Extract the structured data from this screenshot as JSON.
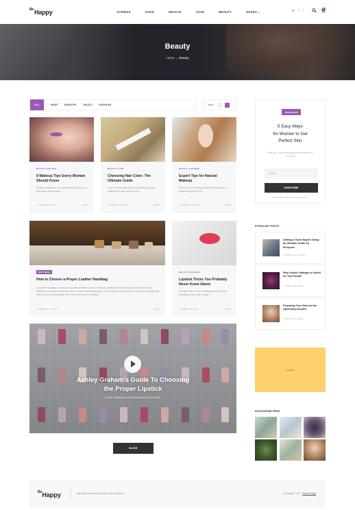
{
  "header": {
    "logo_prefix": "Be",
    "logo_main": "Happy",
    "nav": [
      "FITNESS",
      "FOOD",
      "HEALTH",
      "LOVE",
      "BEAUTY",
      "PAGES"
    ],
    "pages_caret": "⌄",
    "social": [
      "◙",
      "f",
      "t"
    ],
    "cart_count": "0"
  },
  "hero": {
    "title": "Beauty",
    "crumb_home": "Home",
    "crumb_arrow": "→",
    "crumb_current": "Beauty"
  },
  "filter": {
    "items": [
      "ALL",
      "HAIR",
      "MAKEUP",
      "NAILS",
      "FASHION"
    ],
    "view_label": "View"
  },
  "cards": [
    {
      "category": "BEAUTY, MAKEUP",
      "title": "8 Makeup Tips Every Woman Should Know",
      "excerpt": "Makeup techniques now seem easy to follow, but they show great results...",
      "date": "JANUARY 3, 2017",
      "views": "324"
    },
    {
      "category": "BEAUTY, HAIR",
      "title": "Choosing Hair Color: The Ultimate Guide",
      "excerpt": "Your most beautiful hair color will bring out the subtleties of your skin and eye...",
      "date": "JANUARY 22, 2017",
      "views": "228"
    },
    {
      "category": "BEAUTY, FASHION",
      "title": "Expert Tips for Natural Makeup",
      "excerpt": "Whether you're easing yourself into makeup or would simply like to try...",
      "date": "JANUARY 20, 2017",
      "views": "323"
    },
    {
      "tag": "MUST READ",
      "title": "How to Choose a Proper Leather Handbag",
      "excerpt": "A Leather Handbag is an accessory that will often come in handy. A quality leather handbag should last ten years. Whether you choose a timeless black or brown leather handbag, or something more colourful, it should be a design that reflects your personal style. Here are a few tips for choosing...",
      "date": "FEBRUARY 1, 2017",
      "views": "424"
    },
    {
      "category": "BEAUTY, FASHION",
      "title": "Lipstick Tricks You Probably Never Knew About",
      "excerpt": "You don't have to be a makeup genius to know that lipstick can make a huge...",
      "date": "MARCH 22, 2017",
      "views": "378"
    }
  ],
  "video": {
    "title_line1": "Ashley Graham's Guide To Choosing",
    "title_line2": "the Proper Lipstick",
    "subtitle": "Let our makeup expert show you how it's done."
  },
  "more_label": "MORE",
  "sidebar": {
    "offer_badge": "FREE OFFER",
    "offer_heading_1": "5 Easy Ways",
    "offer_heading_2": "for Women to Get",
    "offer_heading_3": "Perfect Skin",
    "offer_text": "Enter your e-mail below and get this resource e-book free!",
    "email_placeholder": "E-mail",
    "subscribe_label": "SUBSCRIBE",
    "privacy": "100% Privacy. We will never spam you!",
    "popular_title": "POPULAR POSTS",
    "popular": [
      {
        "title": "Getting a Good Night's Sleep: an Ultimate Guide for Everyone",
        "date": "APRIL 10, 2017",
        "views": "324"
      },
      {
        "title": "Why Purple Cabbage Is Useful for Your Health",
        "date": "JUNE 5, 2017",
        "views": "324"
      },
      {
        "title": "Preparing Your Skin for the Upcoming Summer",
        "date": "MAY 9, 2017",
        "views": "324"
      }
    ],
    "ad_label": "google",
    "instagram_title": "INSTAGRAM FEED"
  },
  "footer": {
    "logo_prefix": "Be",
    "logo_main": "Happy",
    "tagline": "Best blog about food, fitness, health, and love.",
    "copyright": "Be Happy © 2017.",
    "privacy_link": "Privacy Policy"
  }
}
